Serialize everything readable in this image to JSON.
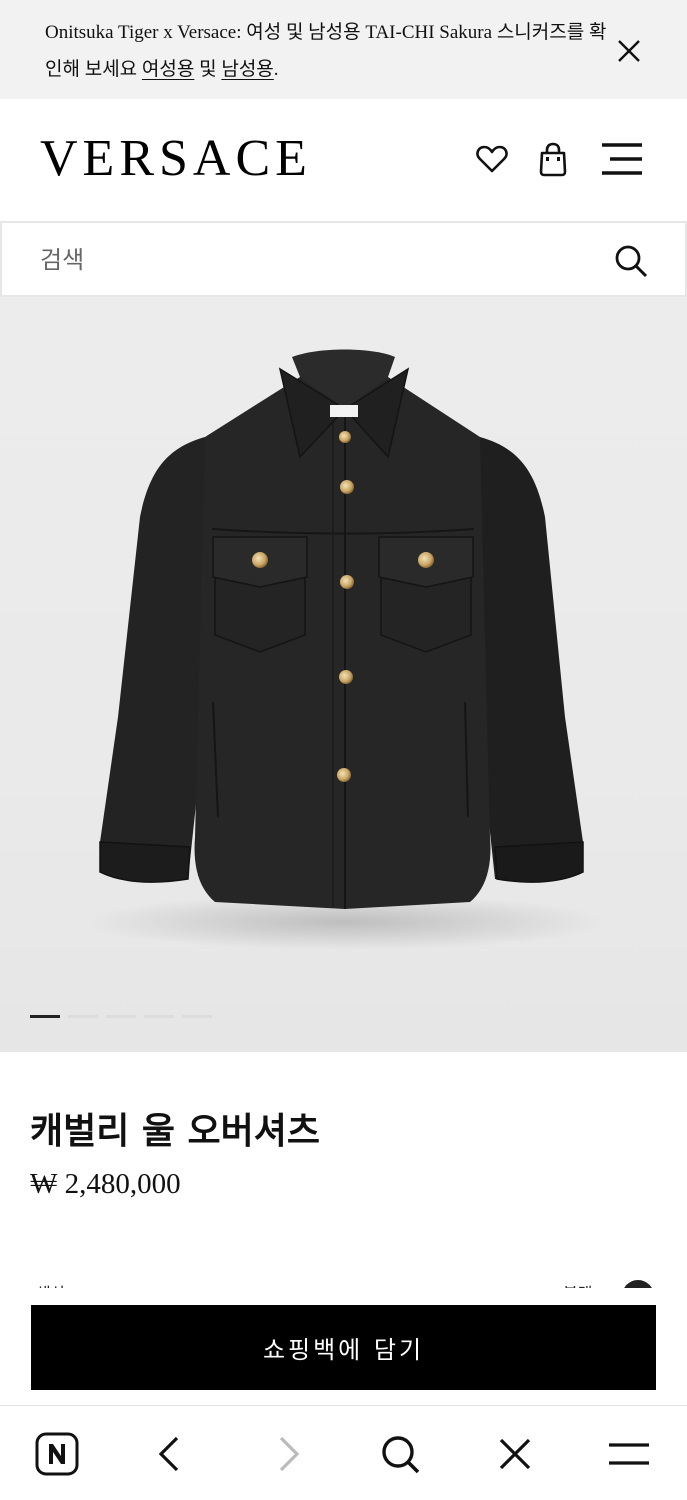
{
  "banner": {
    "text_prefix": "Onitsuka Tiger x Versace: 여성 및 남성용 TAI-CHI Sakura 스니커즈를 확인해 보세요 ",
    "link_women": "여성용",
    "connector": " 및 ",
    "link_men": "남성용",
    "suffix": ".",
    "close_icon": "close-icon"
  },
  "header": {
    "logo": "VERSACE",
    "icons": [
      "heart-icon",
      "shopping-bag-icon",
      "menu-icon"
    ]
  },
  "search": {
    "placeholder": "검색",
    "icon": "search-icon"
  },
  "gallery": {
    "image": "black wool overshirt with gold medusa buttons",
    "slide_count": 5,
    "active_slide": 1
  },
  "product": {
    "name": "캐벌리 울 오버셔츠",
    "price": "₩ 2,480,000",
    "partial_left": "색상",
    "partial_right": "블랙"
  },
  "add_to_bag": {
    "label": "쇼핑백에 담기"
  },
  "browser_bar": {
    "icons": [
      "naver-home-icon",
      "back-icon",
      "forward-icon",
      "search-icon",
      "close-icon",
      "menu-icon"
    ]
  },
  "colors": {
    "banner_bg": "#f2f2f2",
    "button_bg": "#000000",
    "button_text": "#ffffff"
  }
}
